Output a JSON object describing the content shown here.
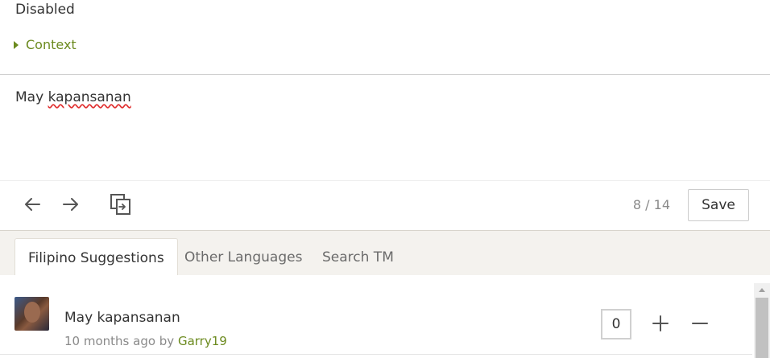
{
  "source": {
    "text": "Disabled",
    "context_label": "Context"
  },
  "editor": {
    "translation_prefix": "May ",
    "translation_misspelled": "kapansanan"
  },
  "toolbar": {
    "prev_icon": "arrow-left-icon",
    "next_icon": "arrow-right-icon",
    "copy_icon": "copy-source-icon",
    "counter": "8 / 14",
    "save_label": "Save"
  },
  "tabs": [
    {
      "label": "Filipino Suggestions",
      "active": true
    },
    {
      "label": "Other Languages",
      "active": false
    },
    {
      "label": "Search TM",
      "active": false
    }
  ],
  "suggestions": [
    {
      "text": "May kapansanan",
      "time": "10 months ago",
      "by": " by ",
      "author": "Garry19",
      "votes": "0"
    }
  ],
  "colors": {
    "accent": "#6b8a1e",
    "tabbar_bg": "#f4f2ee",
    "spell_error": "#e03030"
  }
}
